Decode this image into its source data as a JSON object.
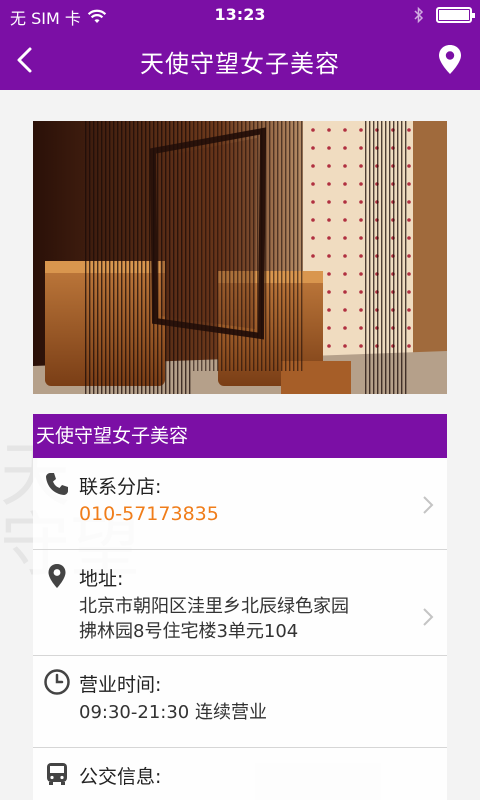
{
  "status_bar": {
    "carrier": "无 SIM 卡",
    "time": "13:23",
    "icons": [
      "wifi-icon",
      "bluetooth-icon",
      "battery-icon"
    ]
  },
  "nav": {
    "title": "天使守望女子美容",
    "back_icon": "chevron-left-icon",
    "location_icon": "location-pin-icon"
  },
  "photo": {
    "subject": "salon interior with wooden bath tubs and string curtains"
  },
  "shop": {
    "name": "天使守望女子美容"
  },
  "details": {
    "contact": {
      "label": "联系分店:",
      "value": "010-57173835"
    },
    "address": {
      "label": "地址:",
      "line1": "北京市朝阳区洼里乡北辰绿色家园",
      "line2": "拂林园8号住宅楼3单元104"
    },
    "hours": {
      "label": "营业时间:",
      "value": "09:30-21:30 连续营业"
    },
    "transit": {
      "label": "公交信息:"
    }
  },
  "colors": {
    "brand_purple": "#7b0fa5",
    "phone_orange": "#f07d1a"
  }
}
